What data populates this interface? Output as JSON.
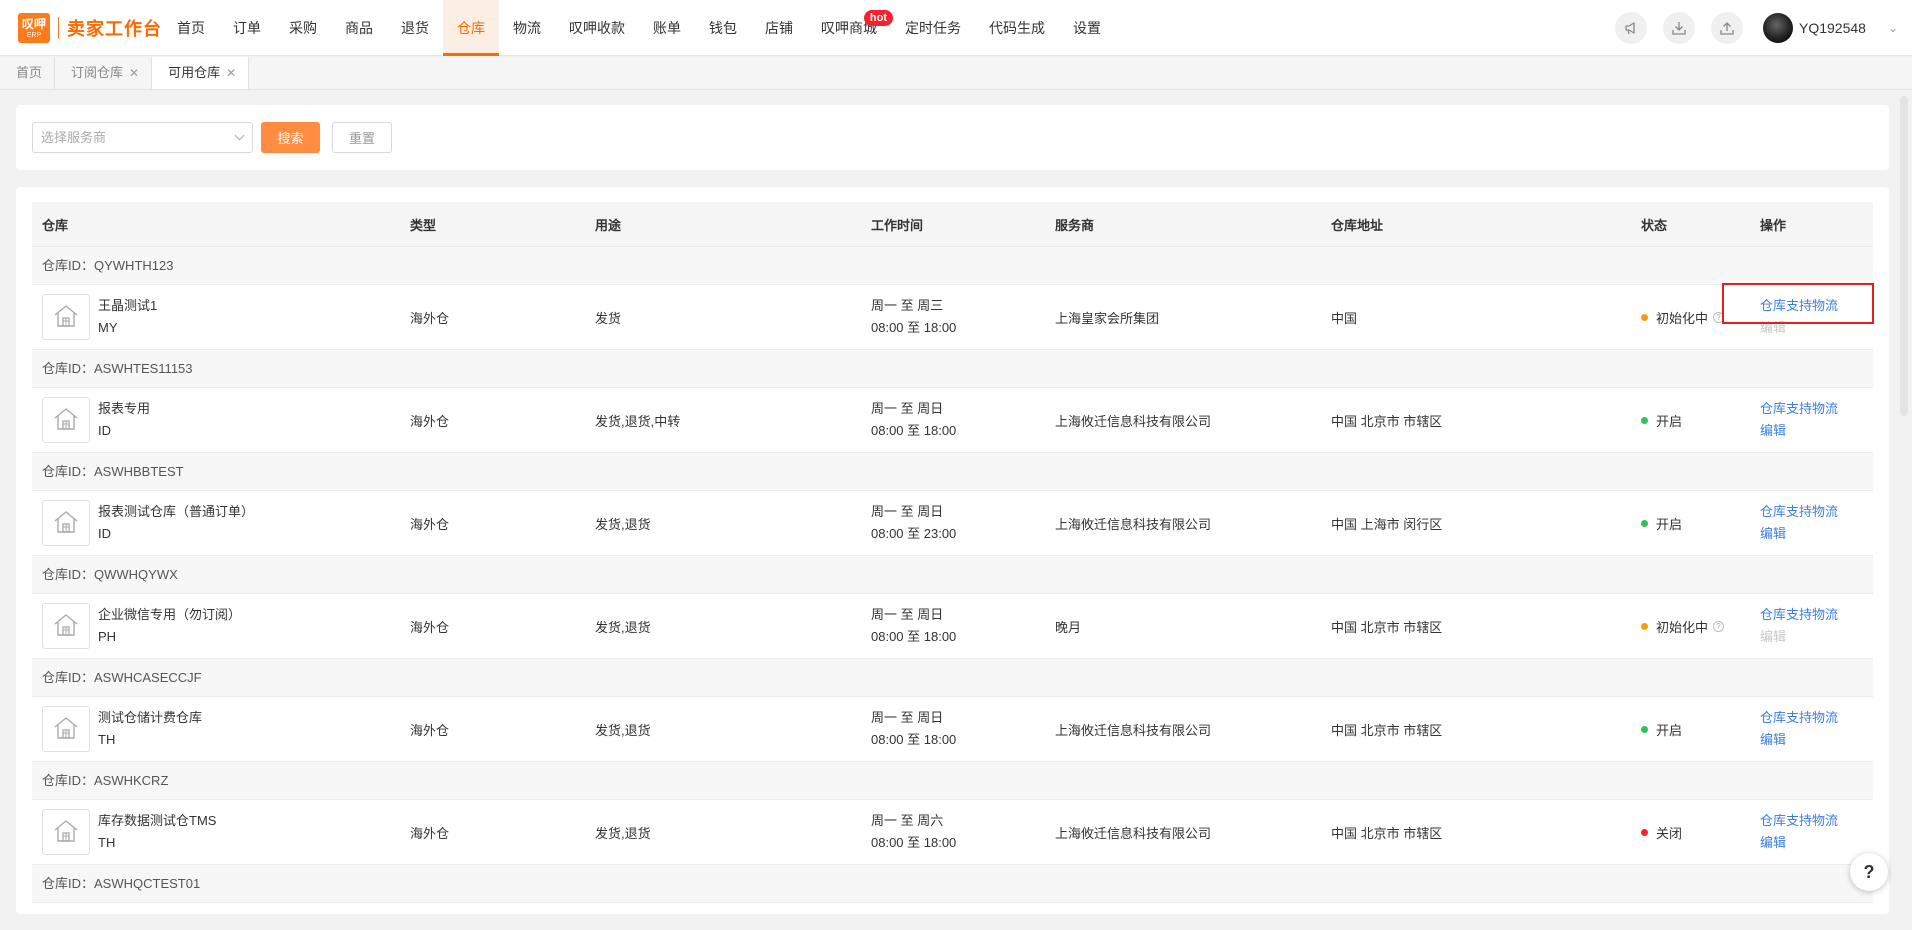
{
  "logo": {
    "badge_top": "叹呷",
    "badge_bottom": "ERP",
    "title": "卖家工作台"
  },
  "nav": {
    "items": [
      {
        "label": "首页"
      },
      {
        "label": "订单"
      },
      {
        "label": "采购"
      },
      {
        "label": "商品"
      },
      {
        "label": "退货"
      },
      {
        "label": "仓库",
        "active": true
      },
      {
        "label": "物流"
      },
      {
        "label": "叹呷收款"
      },
      {
        "label": "账单"
      },
      {
        "label": "钱包"
      },
      {
        "label": "店铺"
      },
      {
        "label": "叹呷商城",
        "badge": "hot"
      },
      {
        "label": "定时任务"
      },
      {
        "label": "代码生成"
      },
      {
        "label": "设置"
      }
    ]
  },
  "user": {
    "name": "YQ192548"
  },
  "tabs": [
    {
      "label": "首页"
    },
    {
      "label": "订阅仓库",
      "closable": true
    },
    {
      "label": "可用仓库",
      "closable": true,
      "active": true
    }
  ],
  "filter": {
    "provider_placeholder": "选择服务商",
    "search_label": "搜索",
    "reset_label": "重置"
  },
  "table": {
    "headers": [
      "仓库",
      "类型",
      "用途",
      "工作时间",
      "服务商",
      "仓库地址",
      "状态",
      "操作"
    ],
    "groups": [
      {
        "id_label": "仓库ID：QYWHTH123",
        "name": "王晶测试1",
        "code": "MY",
        "type": "海外仓",
        "usage": "发货",
        "days": "周一 至 周三",
        "hours": "08:00 至 18:00",
        "provider": "上海皇家会所集团",
        "address": "中国",
        "status": "初始化中",
        "status_color": "#fa9a14",
        "has_help": true,
        "op1": "仓库支持物流",
        "op2": "编辑",
        "op2_disabled": true
      },
      {
        "id_label": "仓库ID：ASWHTES11153",
        "name": "报表专用",
        "code": "ID",
        "type": "海外仓",
        "usage": "发货,退货,中转",
        "days": "周一 至 周日",
        "hours": "08:00 至 18:00",
        "provider": "上海攸迁信息科技有限公司",
        "address": "中国 北京市 市辖区",
        "status": "开启",
        "status_color": "#2fc25b",
        "has_help": false,
        "op1": "仓库支持物流",
        "op2": "编辑",
        "op2_disabled": false
      },
      {
        "id_label": "仓库ID：ASWHBBTEST",
        "name": "报表测试仓库（普通订单）",
        "code": "ID",
        "type": "海外仓",
        "usage": "发货,退货",
        "days": "周一 至 周日",
        "hours": "08:00 至 23:00",
        "provider": "上海攸迁信息科技有限公司",
        "address": "中国 上海市 闵行区",
        "status": "开启",
        "status_color": "#2fc25b",
        "has_help": false,
        "op1": "仓库支持物流",
        "op2": "编辑",
        "op2_disabled": false
      },
      {
        "id_label": "仓库ID：QWWHQYWX",
        "name": "企业微信专用（勿订阅）",
        "code": "PH",
        "type": "海外仓",
        "usage": "发货,退货",
        "days": "周一 至 周日",
        "hours": "08:00 至 18:00",
        "provider": "晚月",
        "address": "中国 北京市 市辖区",
        "status": "初始化中",
        "status_color": "#fa9a14",
        "has_help": true,
        "op1": "仓库支持物流",
        "op2": "编辑",
        "op2_disabled": true
      },
      {
        "id_label": "仓库ID：ASWHCASECCJF",
        "name": "测试仓储计费仓库",
        "code": "TH",
        "type": "海外仓",
        "usage": "发货,退货",
        "days": "周一 至 周日",
        "hours": "08:00 至 18:00",
        "provider": "上海攸迁信息科技有限公司",
        "address": "中国 北京市 市辖区",
        "status": "开启",
        "status_color": "#2fc25b",
        "has_help": false,
        "op1": "仓库支持物流",
        "op2": "编辑",
        "op2_disabled": false
      },
      {
        "id_label": "仓库ID：ASWHKCRZ",
        "name": "库存数据测试仓TMS",
        "code": "TH",
        "type": "海外仓",
        "usage": "发货,退货",
        "days": "周一 至 周六",
        "hours": "08:00 至 18:00",
        "provider": "上海攸迁信息科技有限公司",
        "address": "中国 北京市 市辖区",
        "status": "关闭",
        "status_color": "#f5222d",
        "has_help": false,
        "op1": "仓库支持物流",
        "op2": "编辑",
        "op2_disabled": false
      }
    ],
    "last_group_id_label": "仓库ID：ASWHQCTEST01"
  },
  "help_button": "?"
}
